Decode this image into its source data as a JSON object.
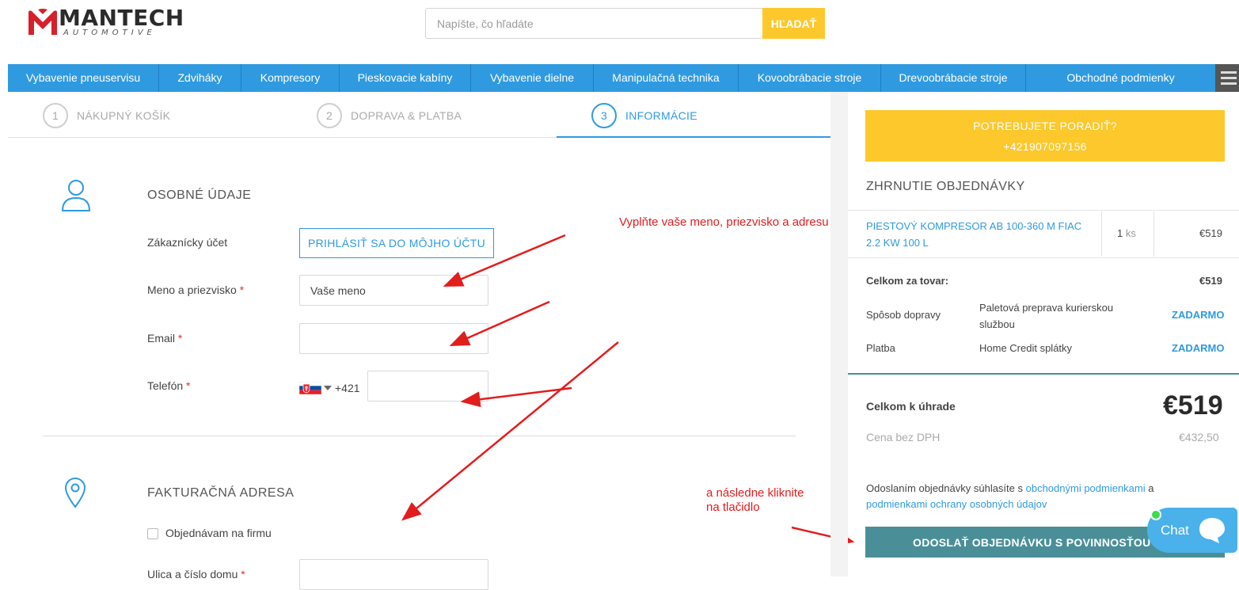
{
  "header": {
    "logo_text": "MANTECH",
    "logo_sub": "AUTOMOTIVE",
    "search_placeholder": "Napíšte, čo hľadáte",
    "search_button": "HĽADAŤ"
  },
  "nav": {
    "items": [
      {
        "label": "Vybavenie pneuservisu"
      },
      {
        "label": "Zdviháky"
      },
      {
        "label": "Kompresory"
      },
      {
        "label": "Pieskovacie kabíny"
      },
      {
        "label": "Vybavenie dielne"
      },
      {
        "label": "Manipulačná technika"
      },
      {
        "label": "Kovoobrábacie stroje"
      },
      {
        "label": "Drevoobrábacie stroje"
      },
      {
        "label": "Obchodné podmienky"
      }
    ],
    "menu_icon": "hamburger-icon"
  },
  "steps": [
    {
      "number": "1",
      "label": "NÁKUPNÝ KOŠÍK",
      "active": false
    },
    {
      "number": "2",
      "label": "DOPRAVA & PLATBA",
      "active": false
    },
    {
      "number": "3",
      "label": "INFORMÁCIE",
      "active": true
    }
  ],
  "personal": {
    "title": "OSOBNÉ ÚDAJE",
    "icon": "user-icon",
    "account_label": "Zákaznícky účet",
    "login_button": "PRIHLÁSIŤ SA DO MÔJHO ÚČTU",
    "name_label": "Meno a priezvisko",
    "name_value": "Vaše meno",
    "email_label": "Email",
    "email_value": "",
    "phone_label": "Telefón",
    "phone_prefix": "+421",
    "phone_value": "",
    "required_mark": "*"
  },
  "billing": {
    "title": "FAKTURAČNÁ ADRESA",
    "icon": "location-pin-icon",
    "company_checkbox_label": "Objednávam na firmu",
    "street_label": "Ulica a číslo domu"
  },
  "annotations": {
    "note_fill": "Vyplňte vaše meno, priezvisko a adresu",
    "note_click_line1": "a následne kliknite",
    "note_click_line2": "na tlačidlo",
    "color": "#e21d1d"
  },
  "sidebar": {
    "advice_line1": "POTREBUJETE PORADIŤ?",
    "advice_line2": "+421907097156",
    "summary_title": "ZHRNUTIE OBJEDNÁVKY",
    "product": {
      "name_line1": "PIESTOVÝ KOMPRESOR AB 100-360 M FIAC",
      "name_line2": "2.2 KW 100 L",
      "qty": "1",
      "qty_unit": "ks",
      "price": "€519"
    },
    "goods_total_label": "Celkom za tovar:",
    "goods_total_value": "€519",
    "shipping_label": "Spôsob dopravy",
    "shipping_method_line1": "Paletová preprava kurierskou",
    "shipping_method_line2": "službou",
    "shipping_price": "ZADARMO",
    "payment_label": "Platba",
    "payment_method": "Home Credit splátky",
    "payment_price": "ZADARMO",
    "grand_label": "Celkom k úhrade",
    "grand_value": "€519",
    "net_label": "Cena bez DPH",
    "net_value": "€432,50",
    "terms_prefix": "Odoslaním objednávky súhlasíte s ",
    "terms_link1": "obchodnými podmienkami",
    "terms_mid": " a",
    "terms_link2": "podmienkami ochrany osobných údajov",
    "order_button": "ODOSLAŤ OBJEDNÁVKU S POVINNOSŤOU PLATBY"
  },
  "chat": {
    "label": "Chat",
    "icon": "chat-bubble-icon"
  },
  "colors": {
    "accent_blue": "#2f9ae0",
    "accent_yellow": "#fcc82c",
    "order_button": "#4a8f98"
  }
}
